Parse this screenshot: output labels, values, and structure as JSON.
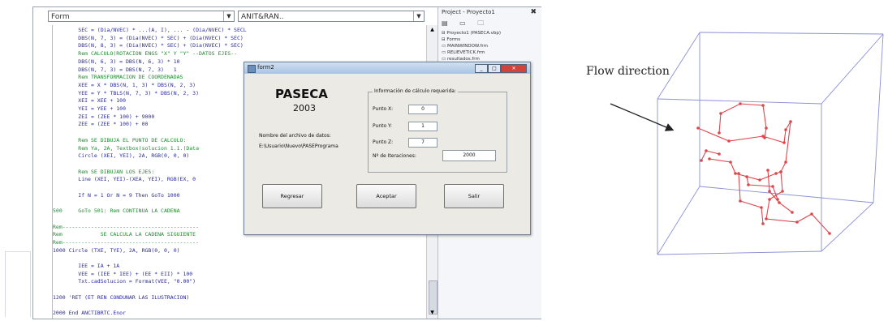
{
  "ide": {
    "left_dropdown": "Form",
    "right_dropdown": "ANIT&RAN..",
    "code_lines": [
      "        SEC = (Dia/NVEC) * ...(A, I), ... - (Dia/NVEC) * SECL",
      "        DBS(N, 7, 3) = (Dia(NVEC) * SEC) + (Dia(NVEC) * SEC)",
      "        DBS(N, 8, 3) = (Dia(NVEC) * SEC) + (Dia(NVEC) * SEC)",
      "        Rem CALCULO(ROTACION ENGS \"X\" Y \"Y\" --DATOS EJES--",
      "        DBS(N, 6, 3) = DBS(N, 6, 3) * 10",
      "        DBS(N, 7, 3) = DBS(N, 7, 3)   1",
      "        Rem TRANSFORMACION DE COORDENADAS",
      "        XEE = X * DBS(N, 1, 3) * DBS(N, 2, 3)",
      "        YEE = Y * TBLS(N, 7, 3) * DBS(N, 2, 3)",
      "        XEI = XEE + 100",
      "        YEI = YEE + 100",
      "        ZEI = (ZEE * 100) + 9000",
      "        ZEE = (ZEE * 100) + 00",
      "",
      "        Rem SE DIBUJA EL PUNTO DE CALCULO:",
      "        Rem Ya, 2A, Textbox(solucion 1.1.(Data",
      "        Circle (XEI, YEI), 2A, RGB(0, 0, 0)",
      "",
      "        Rem SE DIBUJAN LOS EJES:",
      "        Line (XEI, YEI)-(XEA, YEI), RGB(EX, 0",
      "",
      "        If N = 1 Or N = 9 Then GoTo 1000",
      "",
      "500     GoTo 501: Rem CONTINUA LA CADENA",
      "",
      "Rem-------------------------------------------",
      "Rem            SE CALCULA LA CADENA SIGUIENTE",
      "Rem-------------------------------------------",
      "1000 Circle (TXE, TYE), 2A, RGB(0, 0, 0)",
      "",
      "        IEE = IA + 1A",
      "        VEE = (IEE * IEE) + (EE * EII) * 100",
      "        Txt.cadSolucion = Format(VEE, \"0.00\")",
      "",
      "1200 'RET (ET REN CONDUNAR LAS ILUSTRACION)",
      "",
      "2000 End ANCTIBRTC.Enor"
    ]
  },
  "explorer": {
    "title": "Project - Proyecto1",
    "close": "✖",
    "toolbar": "▤ ▭ 🗀",
    "tree": [
      "⊟ Proyecto1 (PASECA.vbp)",
      "   ⊟ Forms",
      "       ▭ MAINWINDOW.frm",
      "       ▭ RELIEVETICK.frm",
      "       ▭ resultados.frm"
    ]
  },
  "dialog": {
    "title": "form2",
    "app_name": "PASECA",
    "year": "2003",
    "file_label": "Nombre del archivo de datos:",
    "file_path": "E:\\Usuario\\Nuevo\\PASEPrograma",
    "group_title": "Información de cálculo requerida:",
    "fields": [
      {
        "label": "Punto X:",
        "value": "0"
      },
      {
        "label": "Punto Y:",
        "value": "1"
      },
      {
        "label": "Punto Z:",
        "value": "7"
      }
    ],
    "iter_label": "Nº de Iteraciones:",
    "iter_value": "2000",
    "buttons": {
      "back": "Regresar",
      "accept": "Aceptar",
      "exit": "Salir"
    },
    "controls": {
      "min": "_",
      "max": "□",
      "close": "✕"
    }
  },
  "figure": {
    "annotation": "Flow direction",
    "box_color": "#8a90d6",
    "path_color": "#e0454d"
  }
}
